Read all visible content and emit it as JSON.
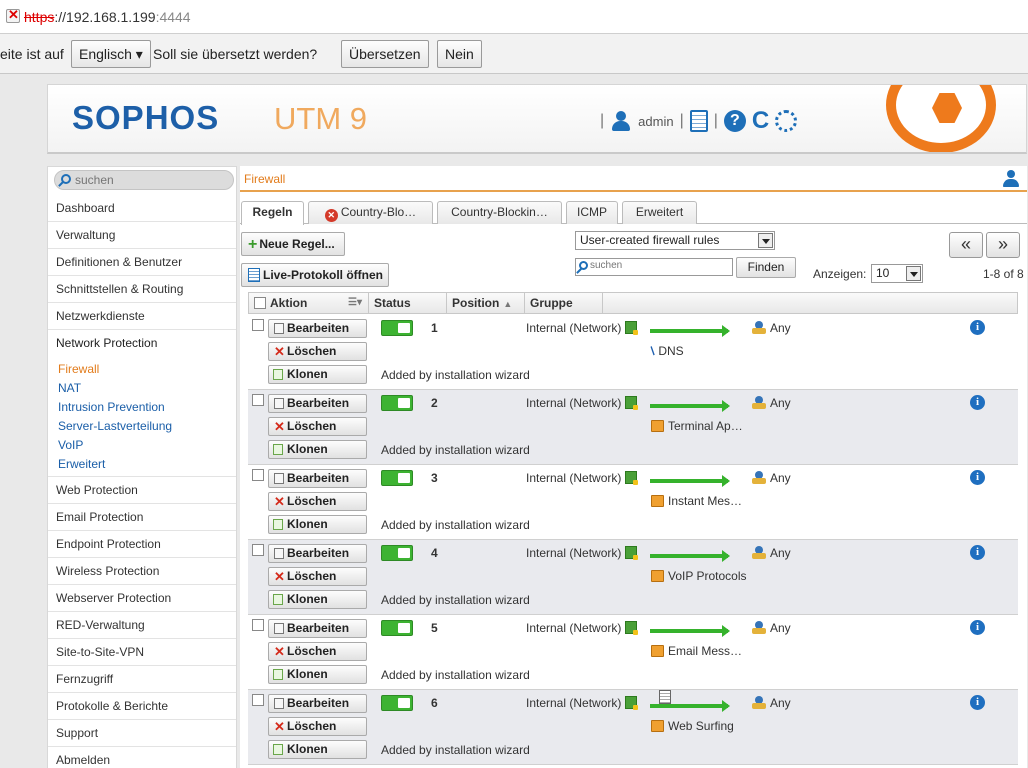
{
  "browser": {
    "url_protocol": "https",
    "url_host": "://192.168.1.199",
    "url_port": ":4444"
  },
  "translate_bar": {
    "prefix": "eite ist auf",
    "language": "Englisch ▾",
    "question": "Soll sie übersetzt werden?",
    "translate_label": "Übersetzen",
    "no_label": "Nein"
  },
  "header": {
    "logo": "SOPHOS",
    "product": "UTM 9",
    "user": "admin"
  },
  "sidebar": {
    "search_placeholder": "suchen",
    "items_top": [
      "Dashboard",
      "Verwaltung",
      "Definitionen & Benutzer",
      "Schnittstellen & Routing",
      "Netzwerkdienste",
      "Network Protection"
    ],
    "subitems": [
      "Firewall",
      "NAT",
      "Intrusion Prevention",
      "Server-Lastverteilung",
      "VoIP",
      "Erweitert"
    ],
    "items_bottom": [
      "Web Protection",
      "Email Protection",
      "Endpoint Protection",
      "Wireless Protection",
      "Webserver Protection",
      "RED-Verwaltung",
      "Site-to-Site-VPN",
      "Fernzugriff",
      "Protokolle & Berichte",
      "Support",
      "Abmelden"
    ]
  },
  "content": {
    "breadcrumb": "Firewall",
    "tabs": [
      "Regeln",
      "Country-Blo…",
      "Country-Blockin…",
      "ICMP",
      "Erweitert"
    ],
    "new_rule_label": "Neue Regel...",
    "live_log_label": "Live-Protokoll öffnen",
    "filter_select": "User-created firewall rules",
    "find_placeholder": "suchen",
    "find_label": "Finden",
    "show_label": "Anzeigen:",
    "show_value": "10",
    "range_label": "1-8 of 8",
    "prev_label": "«",
    "next_label": "»",
    "columns": [
      "Aktion",
      "Status",
      "Position",
      "Gruppe"
    ],
    "actions": {
      "edit": "Bearbeiten",
      "delete": "Löschen",
      "clone": "Klonen"
    },
    "rows": [
      {
        "position": "1",
        "source": "Internal (Network)",
        "destination": "Any",
        "service": "DNS",
        "service_icon": "dns",
        "note": "Added by installation wizard"
      },
      {
        "position": "2",
        "source": "Internal (Network)",
        "destination": "Any",
        "service": "Terminal Ap…",
        "service_icon": "group",
        "note": "Added by installation wizard"
      },
      {
        "position": "3",
        "source": "Internal (Network)",
        "destination": "Any",
        "service": "Instant Mes…",
        "service_icon": "group",
        "note": "Added by installation wizard"
      },
      {
        "position": "4",
        "source": "Internal (Network)",
        "destination": "Any",
        "service": "VoIP Protocols",
        "service_icon": "group",
        "note": "Added by installation wizard"
      },
      {
        "position": "5",
        "source": "Internal (Network)",
        "destination": "Any",
        "service": "Email Mess…",
        "service_icon": "group",
        "note": "Added by installation wizard"
      },
      {
        "position": "6",
        "source": "Internal (Network)",
        "destination": "Any",
        "service": "Web Surfing",
        "service_icon": "group",
        "note": "Added by installation wizard"
      }
    ],
    "colors": {
      "accent_orange": "#e27c1c",
      "brand_blue": "#1d5fa8",
      "enabled_green": "#3db332"
    }
  }
}
